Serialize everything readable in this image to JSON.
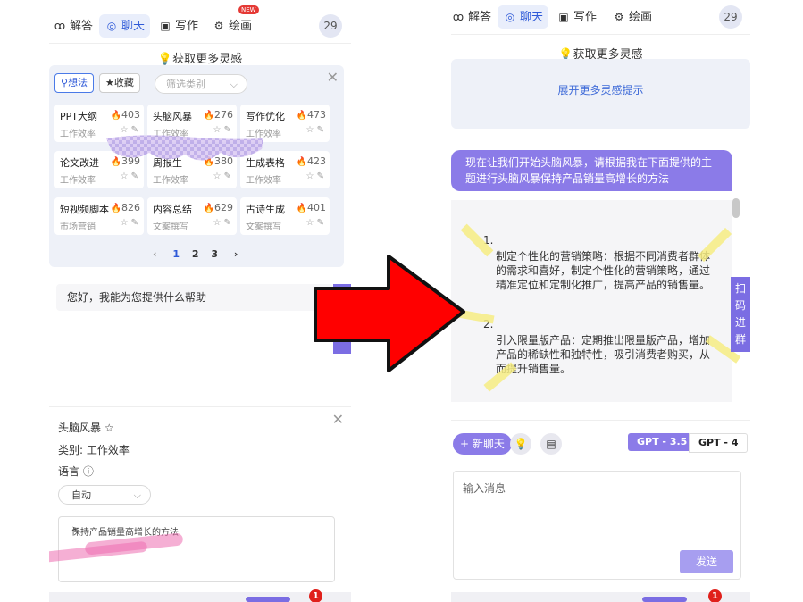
{
  "tabs": [
    {
      "icon": "ꝏ",
      "label": "解答"
    },
    {
      "icon": "◎",
      "label": "聊天"
    },
    {
      "icon": "▣",
      "label": "写作"
    },
    {
      "icon": "⚙",
      "label": "绘画"
    }
  ],
  "new_tag": "NEW",
  "count": "29",
  "inspiration": {
    "title": "获取更多灵感",
    "expand_label": "展开更多灵感提示"
  },
  "filter": {
    "chip_ideas": "想法",
    "chip_favorites": "收藏",
    "select_placeholder": "筛选类别"
  },
  "prompts": [
    {
      "title": "PPT大纲",
      "hot": "403",
      "category": "工作效率"
    },
    {
      "title": "头脑风暴",
      "hot": "276",
      "category": "工作效率"
    },
    {
      "title": "写作优化",
      "hot": "473",
      "category": "工作效率"
    },
    {
      "title": "论文改进",
      "hot": "399",
      "category": "工作效率"
    },
    {
      "title": "周报生",
      "hot": "380",
      "category": "工作效率"
    },
    {
      "title": "生成表格",
      "hot": "423",
      "category": "工作效率"
    },
    {
      "title": "短视频脚本",
      "hot": "826",
      "category": "市场营销"
    },
    {
      "title": "内容总结",
      "hot": "629",
      "category": "文案撰写"
    },
    {
      "title": "古诗生成",
      "hot": "401",
      "category": "文案撰写"
    }
  ],
  "pager": {
    "prev": "‹",
    "pages": [
      "1",
      "2",
      "3"
    ],
    "next": "›"
  },
  "greeting": "您好，我能为您提供什么帮助",
  "detail": {
    "title": "头脑风暴 ☆",
    "category": "类别: 工作效率",
    "language_label": "语言 ⓘ",
    "language_value": "自动",
    "text": "保持产品销量高增长的方法"
  },
  "notification_count": "1",
  "chat": {
    "user_message": "现在让我们开始头脑风暴，请根据我在下面提供的主题进行头脑风暴保持产品销量高增长的方法",
    "reply_lines": [
      "1.",
      "制定个性化的营销策略：根据不同消费者群体",
      "的需求和喜好，制定个性化的营销策略，通过",
      "精准定位和定制化推广，提高产品的销售量。",
      "2.",
      "引入限量版产品：定期推出限量版产品，增加",
      "产品的稀缺性和独特性，吸引消费者购买，从",
      "而提升销售量。"
    ],
    "side_tag": [
      "扫",
      "码",
      "进",
      "群"
    ]
  },
  "actions": {
    "new_chat": "+ 新聊天",
    "gpt35": "GPT - 3.5",
    "gpt4": "GPT - 4"
  },
  "input": {
    "placeholder": "输入消息",
    "send": "发送"
  },
  "colors": {
    "accent_purple": "#8b7be8",
    "accent_blue": "#2f5ad8",
    "arrow_red": "#ff0000"
  }
}
